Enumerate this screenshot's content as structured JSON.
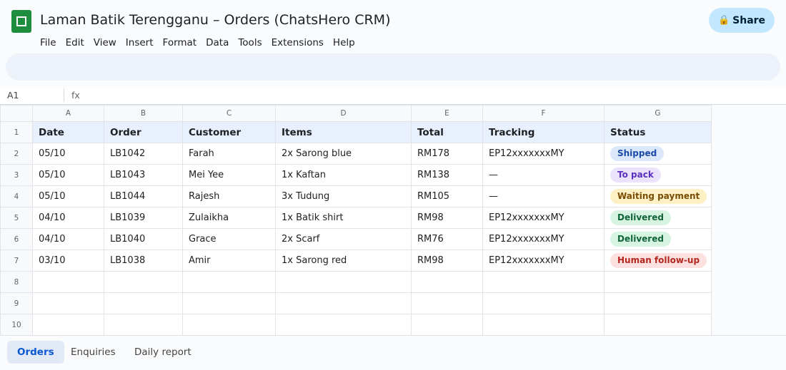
{
  "doc": {
    "title": "Laman Batik Terengganu – Orders (ChatsHero CRM)"
  },
  "menu": [
    "File",
    "Edit",
    "View",
    "Insert",
    "Format",
    "Data",
    "Tools",
    "Extensions",
    "Help"
  ],
  "share": {
    "label": "Share",
    "icon": "lock-icon"
  },
  "formula_bar": {
    "cell_ref": "A1",
    "fx_label": "fx",
    "value": ""
  },
  "columns": [
    "A",
    "B",
    "C",
    "D",
    "E",
    "F",
    "G"
  ],
  "header_row": [
    "Date",
    "Order",
    "Customer",
    "Items",
    "Total",
    "Tracking",
    "Status"
  ],
  "rows": [
    {
      "date": "05/10",
      "order": "LB1042",
      "customer": "Farah",
      "items": "2x Sarong blue",
      "total": "RM178",
      "tracking": "EP12xxxxxxxMY",
      "status": "Shipped"
    },
    {
      "date": "05/10",
      "order": "LB1043",
      "customer": "Mei Yee",
      "items": "1x Kaftan",
      "total": "RM138",
      "tracking": "—",
      "status": "To pack"
    },
    {
      "date": "05/10",
      "order": "LB1044",
      "customer": "Rajesh",
      "items": "3x Tudung",
      "total": "RM105",
      "tracking": "—",
      "status": "Waiting payment"
    },
    {
      "date": "04/10",
      "order": "LB1039",
      "customer": "Zulaikha",
      "items": "1x Batik shirt",
      "total": "RM98",
      "tracking": "EP12xxxxxxxMY",
      "status": "Delivered"
    },
    {
      "date": "04/10",
      "order": "LB1040",
      "customer": "Grace",
      "items": "2x Scarf",
      "total": "RM76",
      "tracking": "EP12xxxxxxxMY",
      "status": "Delivered"
    },
    {
      "date": "03/10",
      "order": "LB1038",
      "customer": "Amir",
      "items": "1x Sarong red",
      "total": "RM98",
      "tracking": "EP12xxxxxxxMY",
      "status": "Human follow-up"
    }
  ],
  "row_numbers": [
    "1",
    "2",
    "3",
    "4",
    "5",
    "6",
    "7",
    "8",
    "9",
    "10"
  ],
  "status_styles": {
    "Shipped": {
      "bg": "#dbe7fb",
      "fg": "#1c4aa8"
    },
    "To pack": {
      "bg": "#ebe3fc",
      "fg": "#5b2fc0"
    },
    "Waiting payment": {
      "bg": "#fdf0c4",
      "fg": "#7a4d05"
    },
    "Delivered": {
      "bg": "#d7f4e3",
      "fg": "#10643a"
    },
    "Human follow-up": {
      "bg": "#fde1e1",
      "fg": "#b3261e"
    }
  },
  "sheet_tabs": [
    "Orders",
    "Enquiries",
    "Daily report"
  ],
  "active_tab": "Orders",
  "colors": {
    "brand": "#1e8e3e",
    "share_bg": "#c2e7ff",
    "header_row_bg": "#e8f0fe"
  }
}
